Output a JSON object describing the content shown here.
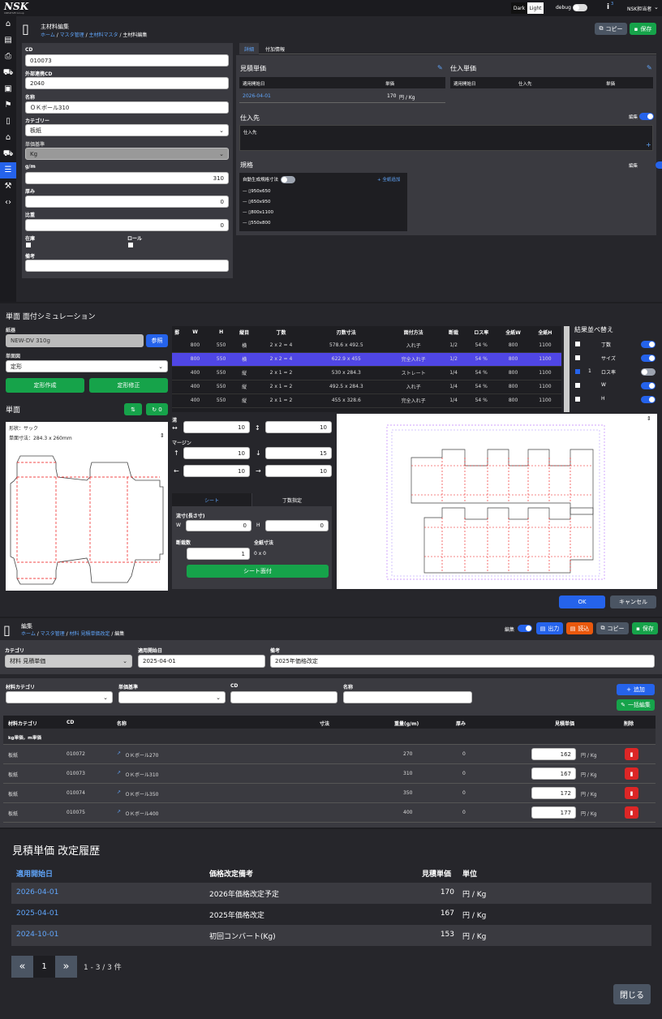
{
  "topbar": {
    "logo": "NSK",
    "logo_sub": "CREATIVE Group",
    "theme_dark": "Dark",
    "theme_light": "Light",
    "debug": "debug",
    "info_badge": "3",
    "user": "NSK担当者"
  },
  "p1": {
    "title": "主材料編集",
    "breadcrumb": [
      "ホーム",
      "マスタ管理",
      "主材料マスタ",
      "主材料編集"
    ],
    "copy": "コピー",
    "save": "保存",
    "form": {
      "cd_label": "CD",
      "cd": "010073",
      "ext_label": "外部連携CD",
      "ext": "2040",
      "name_label": "名称",
      "name": "ＯＫボール310",
      "cat_label": "カテゴリー",
      "cat": "板紙",
      "unit_label": "単価基準",
      "unit": "Kg",
      "gsm_label": "g/m",
      "gsm": "310",
      "thick_label": "厚み",
      "thick": "0",
      "ratio_label": "比重",
      "ratio": "0",
      "stock_label": "在庫",
      "roll_label": "ロール",
      "note_label": "備考"
    },
    "tabs": [
      "詳細",
      "付加情報"
    ],
    "quote": {
      "title": "見積単価",
      "h1": "適用開始日",
      "h2": "単価",
      "date": "2026-04-01",
      "price": "170",
      "unit": "円 / Kg"
    },
    "purchase": {
      "title": "仕入単価",
      "h1": "適用開始日",
      "h2": "仕入先",
      "h3": "単価"
    },
    "supplier": {
      "title": "仕入先",
      "edit": "編集",
      "col": "仕入先"
    },
    "spec": {
      "title": "規格",
      "edit": "編集",
      "auto": "自動生成規格寸法",
      "add": "全紙追加",
      "items": [
        "950x650",
        "650x950",
        "800x1100",
        "550x800"
      ]
    }
  },
  "p2": {
    "title": "単面 面付シミュレーション",
    "paper_label": "紙器",
    "paper": "NEW-DV 310g",
    "ref": "参照",
    "shape_label": "単面図",
    "shape": "定形",
    "make": "定形作成",
    "fix": "定形修正",
    "single": "単面",
    "form_label": "形状：サック",
    "size_label": "単面寸法：284.3 x 260mm",
    "gap_label": "溝",
    "gx": "10",
    "gy": "10",
    "margin_label": "マージン",
    "mt": "10",
    "mb": "15",
    "ml": "10",
    "mr": "10",
    "tab1": "シート",
    "tab2": "丁数指定",
    "cut_label": "流寸(長さ寸)",
    "W": "W",
    "H": "H",
    "wv": "0",
    "hv": "0",
    "count_label": "断裁数",
    "full_label": "全紙寸法",
    "count": "1",
    "full": "0 x 0",
    "sheet_btn": "シート面付",
    "ok": "OK",
    "cancel": "キャンセル",
    "cols": [
      "罫",
      "W",
      "H",
      "縦目",
      "丁数",
      "刃数寸法",
      "面付方法",
      "断裁",
      "ロス率",
      "全紙W",
      "全紙H"
    ],
    "rows": [
      [
        "",
        "800",
        "550",
        "横",
        "2 x 2 = 4",
        "578.6 x 492.5",
        "入れ子",
        "1/2",
        "54 %",
        "800",
        "1100"
      ],
      [
        "",
        "800",
        "550",
        "横",
        "2 x 2 = 4",
        "622.9 x 455",
        "完全入れ子",
        "1/2",
        "54 %",
        "800",
        "1100"
      ],
      [
        "",
        "400",
        "550",
        "縦",
        "2 x 1 = 2",
        "530 x 284.3",
        "ストレート",
        "1/4",
        "54 %",
        "800",
        "1100"
      ],
      [
        "",
        "400",
        "550",
        "縦",
        "2 x 1 = 2",
        "492.5 x 284.3",
        "入れ子",
        "1/4",
        "54 %",
        "800",
        "1100"
      ],
      [
        "",
        "400",
        "550",
        "縦",
        "2 x 1 = 2",
        "455 x 328.6",
        "完全入れ子",
        "1/4",
        "54 %",
        "800",
        "1100"
      ]
    ],
    "sort_title": "結果並べ替え",
    "sorts": [
      [
        "",
        "丁数"
      ],
      [
        "",
        "サイズ"
      ],
      [
        "1",
        "ロス率"
      ],
      [
        "",
        "W"
      ],
      [
        "",
        "H"
      ]
    ]
  },
  "p3": {
    "title": "編集",
    "breadcrumb": [
      "ホーム",
      "マスタ管理",
      "材料 見積単価改定",
      "編集"
    ],
    "edit": "編集",
    "out": "出力",
    "read": "読込",
    "copy": "コピー",
    "save": "保存",
    "cat_label": "カテゴリ",
    "cat": "材料 見積単価",
    "date_label": "適用開始日",
    "date": "2025-04-01",
    "note_label": "備考",
    "note": "2025年価格改定",
    "f_cat": "材料カテゴリ",
    "f_unit": "単価基準",
    "f_cd": "CD",
    "f_name": "名称",
    "add": "追加",
    "bulk": "一括編集",
    "cols": [
      "材料カテゴリ",
      "CD",
      "名称",
      "寸法",
      "重量(g/m)",
      "厚み",
      "見積単価",
      "削除"
    ],
    "group": "kg単価，m単価",
    "rows": [
      [
        "板紙",
        "010072",
        "ＯＫボール270",
        "270",
        "0",
        "162",
        "円 / Kg"
      ],
      [
        "板紙",
        "010073",
        "ＯＫボール310",
        "310",
        "0",
        "167",
        "円 / Kg"
      ],
      [
        "板紙",
        "010074",
        "ＯＫボール350",
        "350",
        "0",
        "172",
        "円 / Kg"
      ],
      [
        "板紙",
        "010075",
        "ＯＫボール400",
        "400",
        "0",
        "177",
        "円 / Kg"
      ]
    ]
  },
  "p4": {
    "title": "見積単価 改定履歴",
    "cols": [
      "適用開始日",
      "価格改定備考",
      "見積単価",
      "単位"
    ],
    "rows": [
      [
        "2026-04-01",
        "2026年価格改定予定",
        "170",
        "円 / Kg"
      ],
      [
        "2025-04-01",
        "2025年価格改定",
        "167",
        "円 / Kg"
      ],
      [
        "2024-10-01",
        "初回コンバート(Kg)",
        "153",
        "円 / Kg"
      ]
    ],
    "page": "1",
    "range": "1 - 3 / 3 件",
    "close": "閉じる"
  }
}
